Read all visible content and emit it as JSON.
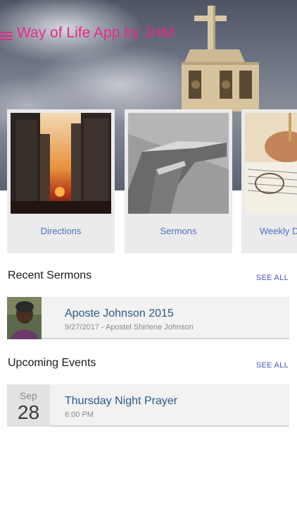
{
  "app": {
    "title": "Way of Life App by JHM"
  },
  "cards": [
    {
      "label": "Directions"
    },
    {
      "label": "Sermons"
    },
    {
      "label": "Weekly De"
    }
  ],
  "recent_sermons": {
    "heading": "Recent Sermons",
    "see_all": "SEE ALL",
    "items": [
      {
        "title": "Aposte Johnson 2015",
        "subtitle": "9/27/2017 - Apostel Shirlene Johnson"
      }
    ]
  },
  "upcoming_events": {
    "heading": "Upcoming Events",
    "see_all": "SEE ALL",
    "items": [
      {
        "month": "Sep",
        "day": "28",
        "title": "Thursday Night Prayer",
        "time": "6:00 PM"
      }
    ]
  },
  "colors": {
    "accent": "#e8288a",
    "link": "#4c6fc7",
    "see_all": "#4a55c8"
  }
}
